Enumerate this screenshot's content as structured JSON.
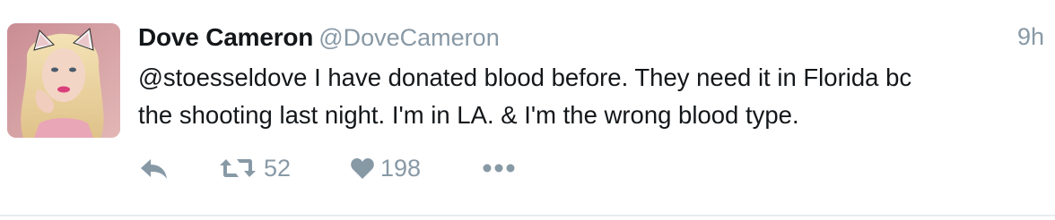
{
  "tweet": {
    "display_name": "Dove Cameron",
    "handle": "@DoveCameron",
    "timestamp": "9h",
    "text_lines": [
      "@stoesseldove I have donated blood before. They need it in Florida bc",
      "the shooting last night. I'm in LA. & I'm the wrong blood type."
    ],
    "actions": {
      "reply_icon": "reply-icon",
      "retweet_icon": "retweet-icon",
      "retweet_count": "52",
      "like_icon": "heart-icon",
      "like_count": "198",
      "more_icon": "more-icon"
    }
  },
  "colors": {
    "text": "#14171a",
    "secondary": "#8899a6",
    "background": "#ffffff"
  }
}
